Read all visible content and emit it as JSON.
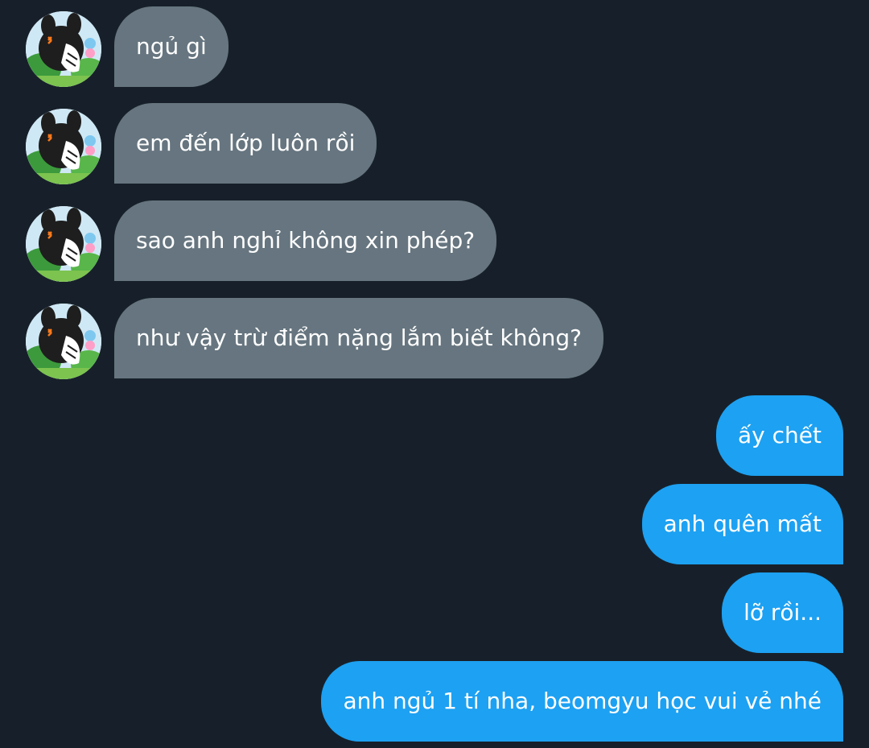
{
  "conversation": {
    "incoming": [
      {
        "text": "ngủ gì"
      },
      {
        "text": "em đến lớp luôn rồi"
      },
      {
        "text": "sao anh nghỉ không xin phép?"
      },
      {
        "text": "như vậy trừ điểm nặng lắm biết không?"
      }
    ],
    "outgoing": [
      {
        "text": "ấy chết"
      },
      {
        "text": "anh quên mất"
      },
      {
        "text": "lỡ rồi..."
      },
      {
        "text": "anh ngủ 1 tí nha, beomgyu học vui vẻ nhé"
      }
    ]
  },
  "avatar": {
    "icon": "cartoon-character-avatar-icon"
  },
  "colors": {
    "background": "#17202a",
    "incoming_bubble": "#66757f",
    "outgoing_bubble": "#1da1f2",
    "text": "#ffffff"
  }
}
